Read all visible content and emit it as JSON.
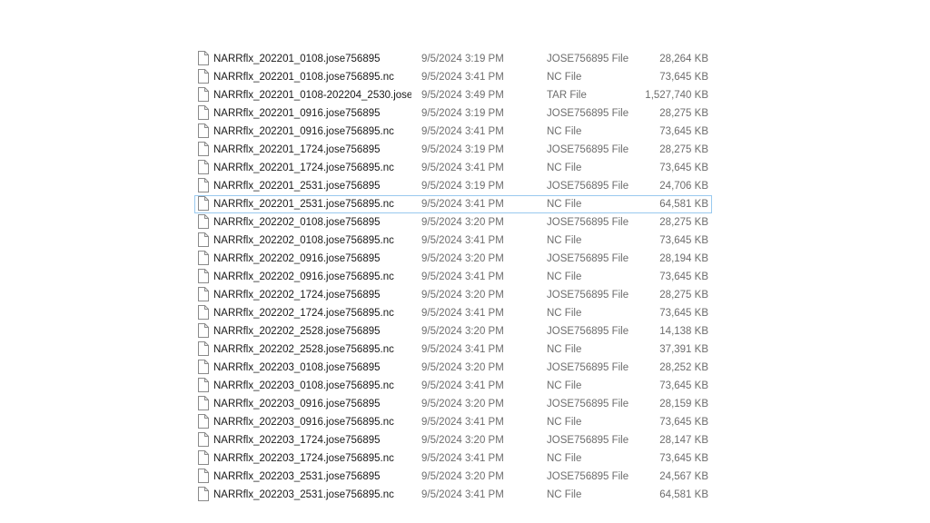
{
  "files": [
    {
      "name": "NARRflx_202201_0108.jose756895",
      "date": "9/5/2024 3:19 PM",
      "type": "JOSE756895 File",
      "size": "28,264 KB"
    },
    {
      "name": "NARRflx_202201_0108.jose756895.nc",
      "date": "9/5/2024 3:41 PM",
      "type": "NC File",
      "size": "73,645 KB"
    },
    {
      "name": "NARRflx_202201_0108-202204_2530.jose7...",
      "date": "9/5/2024 3:49 PM",
      "type": "TAR File",
      "size": "1,527,740 KB"
    },
    {
      "name": "NARRflx_202201_0916.jose756895",
      "date": "9/5/2024 3:19 PM",
      "type": "JOSE756895 File",
      "size": "28,275 KB"
    },
    {
      "name": "NARRflx_202201_0916.jose756895.nc",
      "date": "9/5/2024 3:41 PM",
      "type": "NC File",
      "size": "73,645 KB"
    },
    {
      "name": "NARRflx_202201_1724.jose756895",
      "date": "9/5/2024 3:19 PM",
      "type": "JOSE756895 File",
      "size": "28,275 KB"
    },
    {
      "name": "NARRflx_202201_1724.jose756895.nc",
      "date": "9/5/2024 3:41 PM",
      "type": "NC File",
      "size": "73,645 KB"
    },
    {
      "name": "NARRflx_202201_2531.jose756895",
      "date": "9/5/2024 3:19 PM",
      "type": "JOSE756895 File",
      "size": "24,706 KB"
    },
    {
      "name": "NARRflx_202201_2531.jose756895.nc",
      "date": "9/5/2024 3:41 PM",
      "type": "NC File",
      "size": "64,581 KB"
    },
    {
      "name": "NARRflx_202202_0108.jose756895",
      "date": "9/5/2024 3:20 PM",
      "type": "JOSE756895 File",
      "size": "28,275 KB"
    },
    {
      "name": "NARRflx_202202_0108.jose756895.nc",
      "date": "9/5/2024 3:41 PM",
      "type": "NC File",
      "size": "73,645 KB"
    },
    {
      "name": "NARRflx_202202_0916.jose756895",
      "date": "9/5/2024 3:20 PM",
      "type": "JOSE756895 File",
      "size": "28,194 KB"
    },
    {
      "name": "NARRflx_202202_0916.jose756895.nc",
      "date": "9/5/2024 3:41 PM",
      "type": "NC File",
      "size": "73,645 KB"
    },
    {
      "name": "NARRflx_202202_1724.jose756895",
      "date": "9/5/2024 3:20 PM",
      "type": "JOSE756895 File",
      "size": "28,275 KB"
    },
    {
      "name": "NARRflx_202202_1724.jose756895.nc",
      "date": "9/5/2024 3:41 PM",
      "type": "NC File",
      "size": "73,645 KB"
    },
    {
      "name": "NARRflx_202202_2528.jose756895",
      "date": "9/5/2024 3:20 PM",
      "type": "JOSE756895 File",
      "size": "14,138 KB"
    },
    {
      "name": "NARRflx_202202_2528.jose756895.nc",
      "date": "9/5/2024 3:41 PM",
      "type": "NC File",
      "size": "37,391 KB"
    },
    {
      "name": "NARRflx_202203_0108.jose756895",
      "date": "9/5/2024 3:20 PM",
      "type": "JOSE756895 File",
      "size": "28,252 KB"
    },
    {
      "name": "NARRflx_202203_0108.jose756895.nc",
      "date": "9/5/2024 3:41 PM",
      "type": "NC File",
      "size": "73,645 KB"
    },
    {
      "name": "NARRflx_202203_0916.jose756895",
      "date": "9/5/2024 3:20 PM",
      "type": "JOSE756895 File",
      "size": "28,159 KB"
    },
    {
      "name": "NARRflx_202203_0916.jose756895.nc",
      "date": "9/5/2024 3:41 PM",
      "type": "NC File",
      "size": "73,645 KB"
    },
    {
      "name": "NARRflx_202203_1724.jose756895",
      "date": "9/5/2024 3:20 PM",
      "type": "JOSE756895 File",
      "size": "28,147 KB"
    },
    {
      "name": "NARRflx_202203_1724.jose756895.nc",
      "date": "9/5/2024 3:41 PM",
      "type": "NC File",
      "size": "73,645 KB"
    },
    {
      "name": "NARRflx_202203_2531.jose756895",
      "date": "9/5/2024 3:20 PM",
      "type": "JOSE756895 File",
      "size": "24,567 KB"
    },
    {
      "name": "NARRflx_202203_2531.jose756895.nc",
      "date": "9/5/2024 3:41 PM",
      "type": "NC File",
      "size": "64,581 KB"
    }
  ],
  "focused_index": 8,
  "icon": "generic-file-icon",
  "colors": {
    "focus_border": "#99c9ef",
    "name_text": "#1a1a1a",
    "detail_text": "#6d6d6d"
  }
}
